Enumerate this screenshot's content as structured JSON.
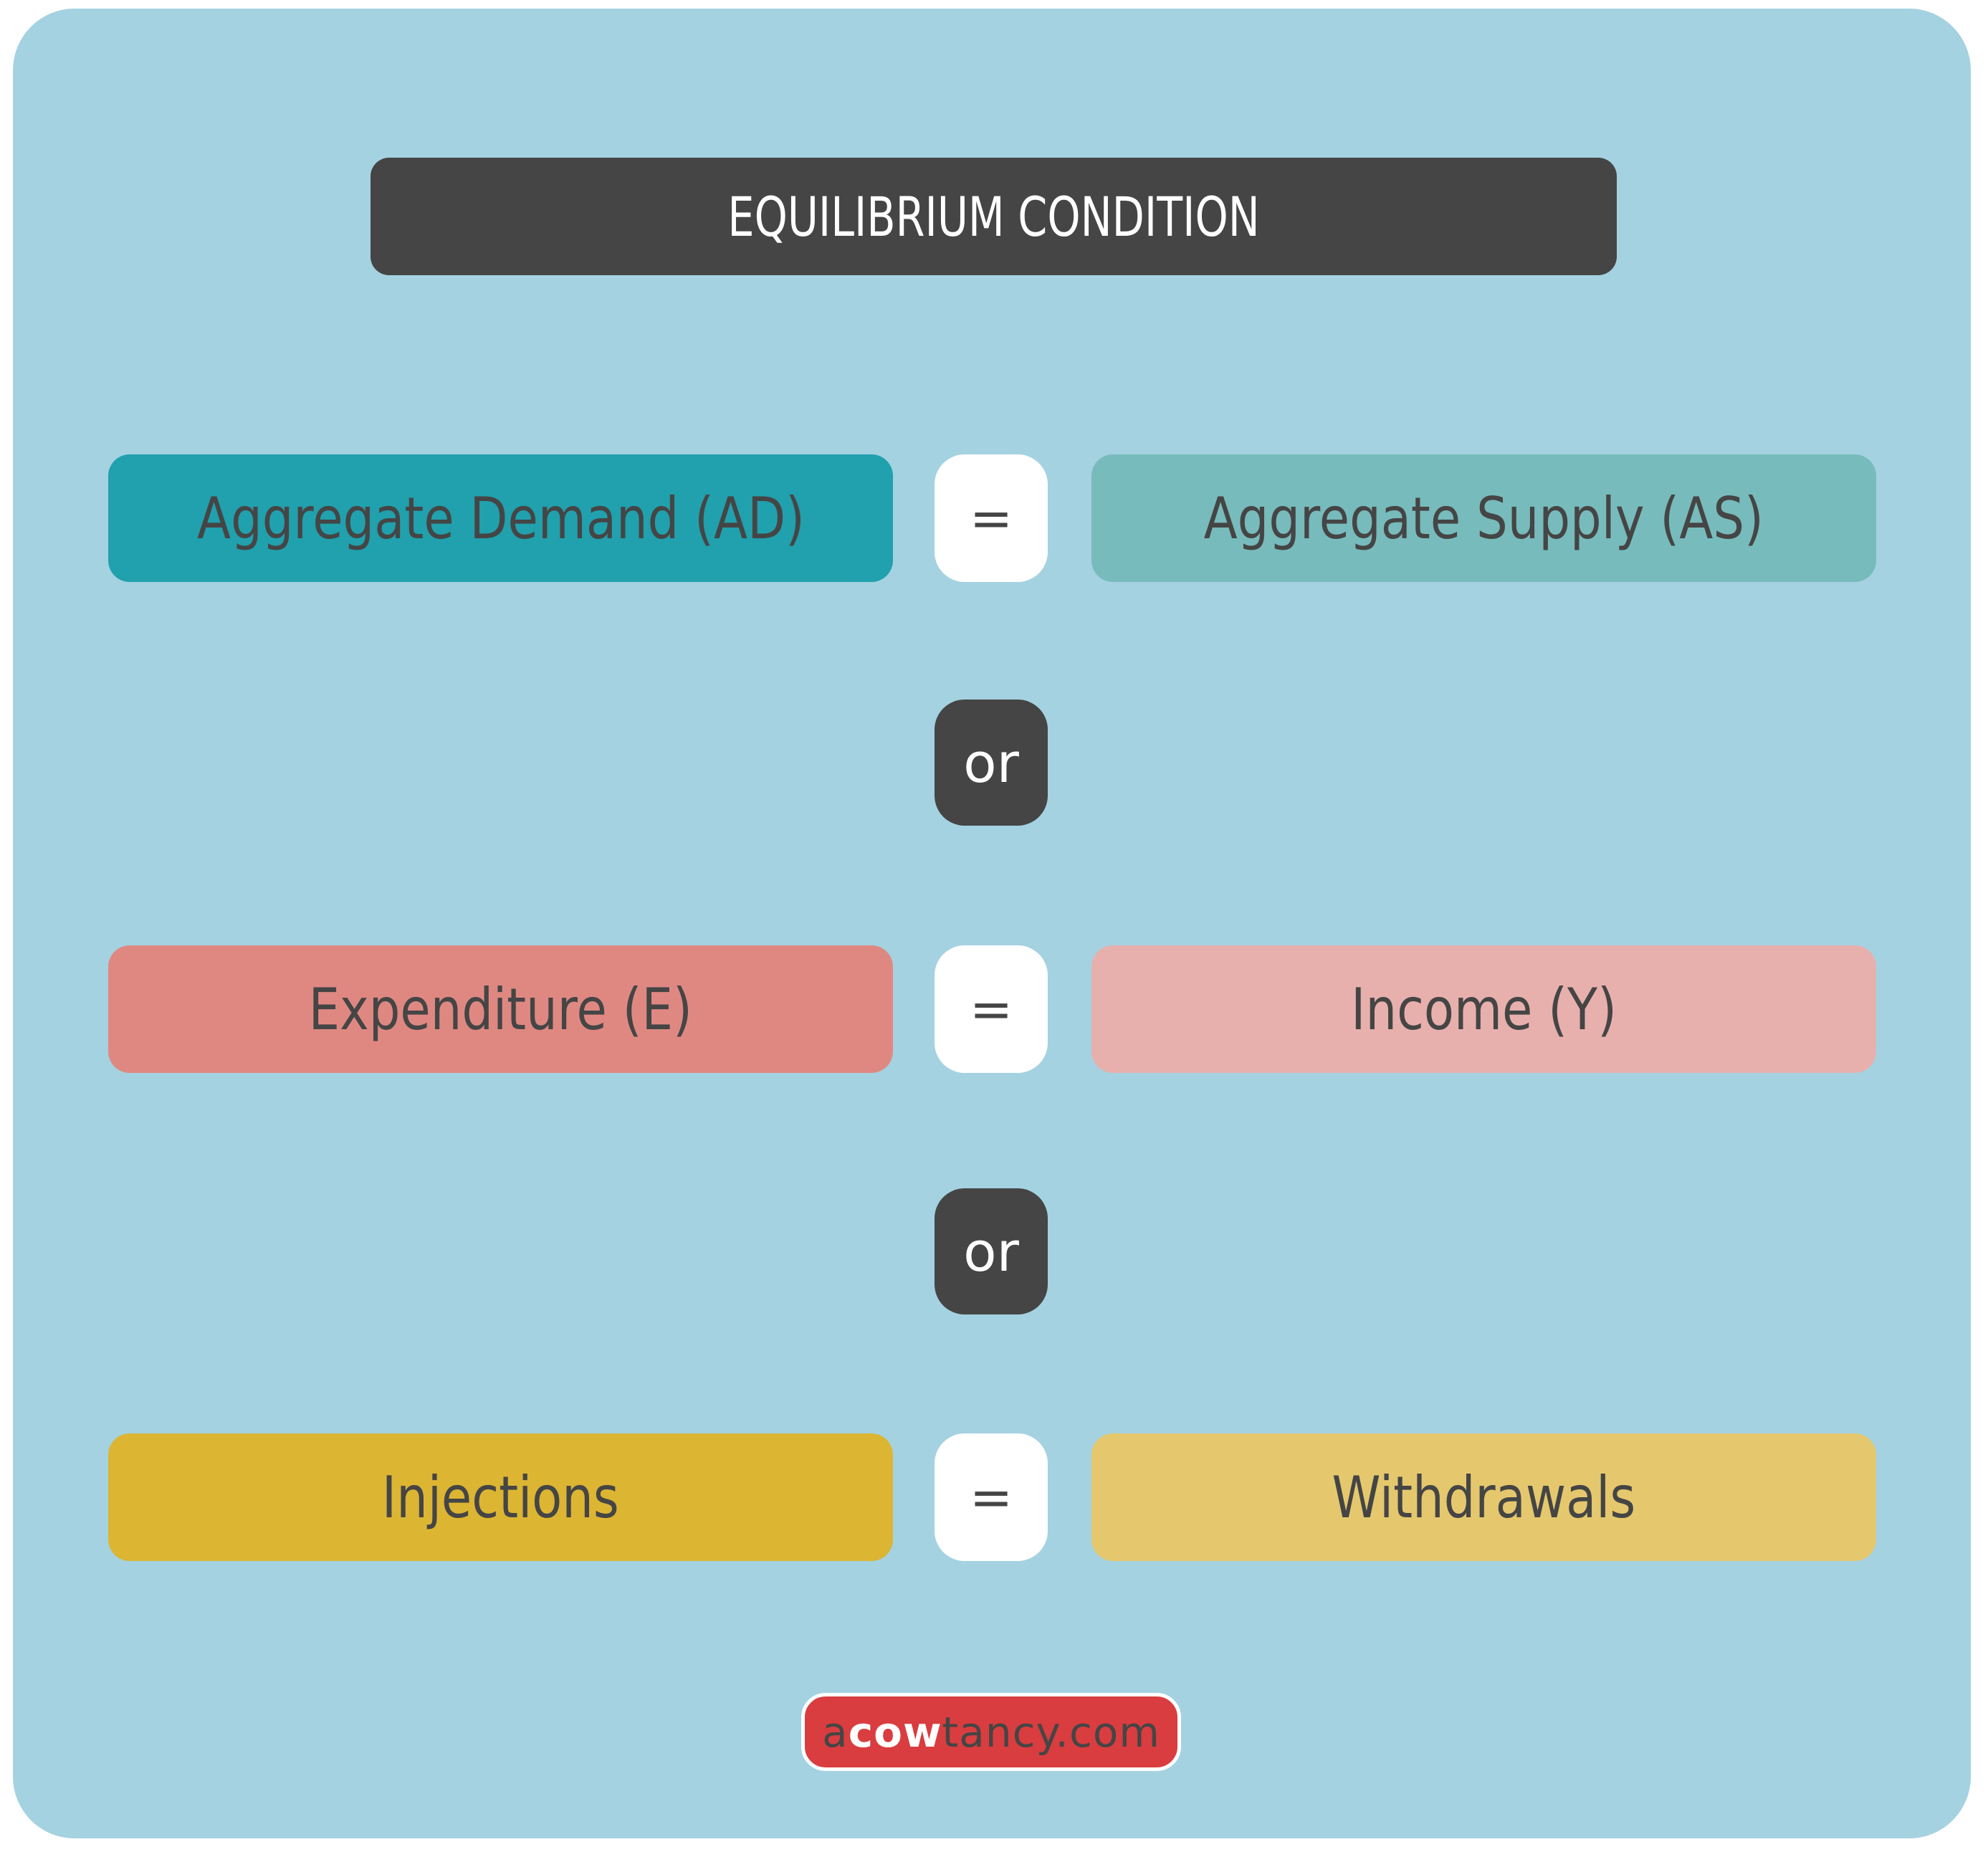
{
  "title": "EQUILIBRIUM CONDITION",
  "colors": {
    "background_panel": "#a4d2e1",
    "title_bg": "#454545",
    "ad": "#21a0ad",
    "as": "#78bbbc",
    "expenditure": "#df8882",
    "income": "#e8b0ad",
    "injections": "#dcb532",
    "withdrawals": "#e5c86d",
    "logo": "#d93d3f"
  },
  "equations": [
    {
      "left": "Aggregate Demand (AD)",
      "operator": "=",
      "right": "Aggregate Supply (AS)"
    },
    {
      "left": "Expenditure (E)",
      "operator": "=",
      "right": "Income (Y)"
    },
    {
      "left": "Injections",
      "operator": "=",
      "right": "Withdrawals"
    }
  ],
  "connectors": [
    "or",
    "or"
  ],
  "logo": {
    "prefix": "a",
    "highlight": "cow",
    "suffix": "tancy.com"
  }
}
